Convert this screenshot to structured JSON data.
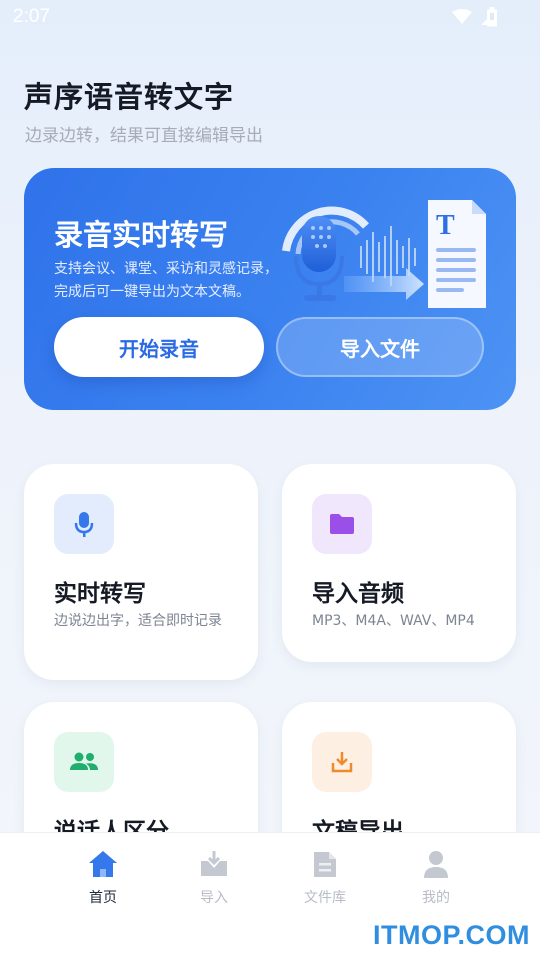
{
  "status_bar": {
    "time": "2:07",
    "icons": [
      "wifi-icon",
      "signal-icon",
      "battery-icon"
    ]
  },
  "header": {
    "title": "声序语音转文字",
    "subtitle": "边录边转，结果可直接编辑导出"
  },
  "hero": {
    "title": "录音实时转写",
    "description": "支持会议、课堂、采访和灵感记录，\n完成后可一键导出为文本文稿。",
    "start_button": "开始录音",
    "import_button": "导入文件",
    "illustration_icons": [
      "microphone-icon",
      "document-icon"
    ],
    "colors": {
      "gradient_start": "#2f72ea",
      "gradient_end": "#4d93f4"
    }
  },
  "features": [
    {
      "title": "实时转写",
      "desc": "边说边出字，适合即时记录",
      "icon": "microphone-icon",
      "icon_bg": "#e2ecfd",
      "icon_color": "#3478ec"
    },
    {
      "title": "导入音频",
      "desc": "MP3、M4A、WAV、MP4",
      "icon": "folder-icon",
      "icon_bg": "#f1e7fd",
      "icon_color": "#9a4fe8"
    },
    {
      "title": "说话人区分",
      "desc": "",
      "icon": "people-icon",
      "icon_bg": "#e1f7ec",
      "icon_color": "#1fae6e"
    },
    {
      "title": "文稿导出",
      "desc": "",
      "icon": "download-icon",
      "icon_bg": "#fdf0e2",
      "icon_color": "#ef8a2c"
    }
  ],
  "bottom_nav": {
    "items": [
      {
        "label": "首页",
        "icon": "home-icon",
        "active": true
      },
      {
        "label": "导入",
        "icon": "import-icon",
        "active": false
      },
      {
        "label": "文件库",
        "icon": "file-library-icon",
        "active": false
      },
      {
        "label": "我的",
        "icon": "profile-icon",
        "active": false
      }
    ]
  },
  "watermark": "ITMOP.COM"
}
